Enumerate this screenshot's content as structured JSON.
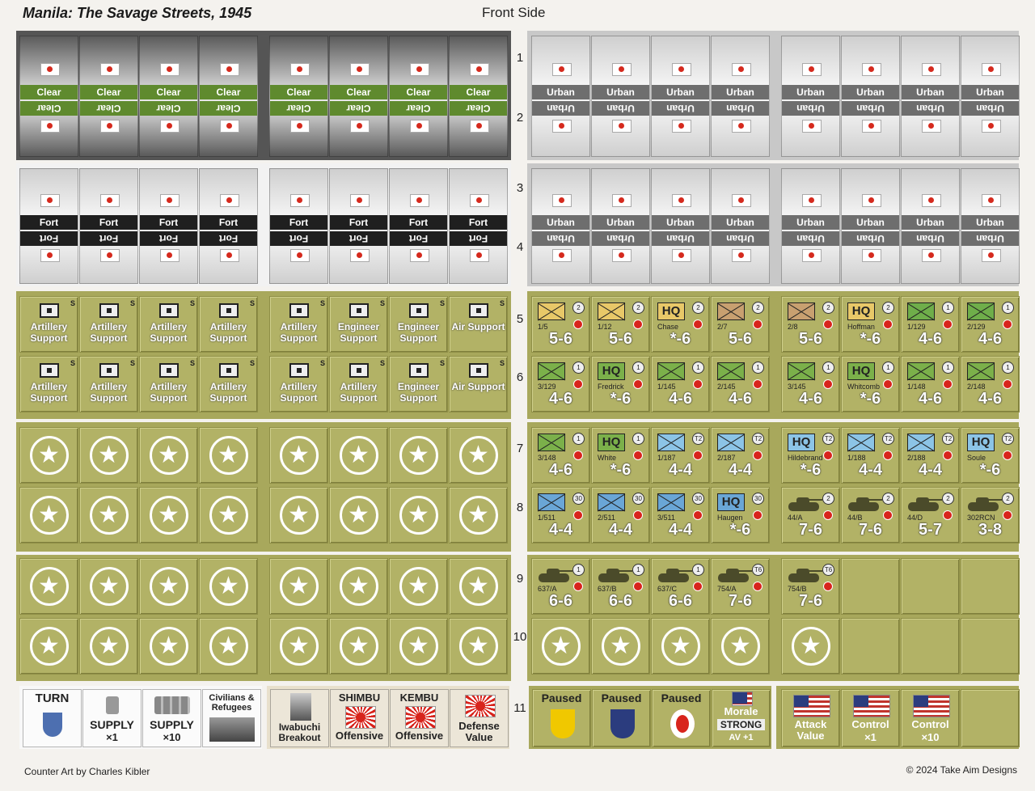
{
  "header": {
    "title": "Manila: The Savage Streets, 1945",
    "side": "Front Side"
  },
  "footer": {
    "credit": "Counter Art by Charles Kibler",
    "copyright": "© 2024 Take Aim Designs"
  },
  "row_numbers": [
    "1",
    "2",
    "3",
    "4",
    "5",
    "6",
    "7",
    "8",
    "9",
    "10",
    "11"
  ],
  "terrain": {
    "clear": "Clear",
    "urban": "Urban",
    "fort": "Fort"
  },
  "support": {
    "badge": "S",
    "row5": [
      "Artillery Support",
      "Artillery Support",
      "Artillery Support",
      "Artillery Support",
      "Artillery Support",
      "Engineer Support",
      "Engineer Support",
      "Air Support"
    ],
    "row6": [
      "Artillery Support",
      "Artillery Support",
      "Artillery Support",
      "Artillery Support",
      "Artillery Support",
      "Artillery Support",
      "Engineer Support",
      "Air Support"
    ]
  },
  "star_glyph": "★",
  "units": {
    "row5": [
      {
        "type": "inf",
        "id": "1/5",
        "str": "5-6",
        "size": "2"
      },
      {
        "type": "inf",
        "id": "1/12",
        "str": "5-6",
        "size": "2"
      },
      {
        "type": "hq",
        "hq": "HQ",
        "id": "Chase",
        "str": "*-6",
        "size": "2"
      },
      {
        "type": "inf",
        "id": "2/7",
        "str": "5-6",
        "size": "2"
      },
      {
        "type": "inf",
        "id": "2/8",
        "str": "5-6",
        "size": "2"
      },
      {
        "type": "hq",
        "hq": "HQ",
        "id": "Hoffman",
        "str": "*-6",
        "size": "2"
      },
      {
        "type": "inf",
        "id": "1/129",
        "str": "4-6",
        "size": "1"
      },
      {
        "type": "inf",
        "id": "2/129",
        "str": "4-6",
        "size": "1"
      }
    ],
    "row6": [
      {
        "type": "inf",
        "id": "3/129",
        "str": "4-6",
        "size": "1"
      },
      {
        "type": "hq",
        "hq": "HQ",
        "id": "Fredrick",
        "str": "*-6",
        "size": "1"
      },
      {
        "type": "inf",
        "id": "1/145",
        "str": "4-6",
        "size": "1"
      },
      {
        "type": "inf",
        "id": "2/145",
        "str": "4-6",
        "size": "1"
      },
      {
        "type": "inf",
        "id": "3/145",
        "str": "4-6",
        "size": "1"
      },
      {
        "type": "hq",
        "hq": "HQ",
        "id": "Whitcomb",
        "str": "*-6",
        "size": "1"
      },
      {
        "type": "inf",
        "id": "1/148",
        "str": "4-6",
        "size": "1"
      },
      {
        "type": "inf",
        "id": "2/148",
        "str": "4-6",
        "size": "1"
      }
    ],
    "row7": [
      {
        "type": "inf",
        "id": "3/148",
        "str": "4-6",
        "size": "1"
      },
      {
        "type": "hq",
        "hq": "HQ",
        "id": "White",
        "str": "*-6",
        "size": "1"
      },
      {
        "type": "inf",
        "id": "1/187",
        "str": "4-4",
        "size": "T2"
      },
      {
        "type": "inf",
        "id": "2/187",
        "str": "4-4",
        "size": "T2"
      },
      {
        "type": "hq",
        "hq": "HQ",
        "id": "Hildebrand",
        "str": "*-6",
        "size": "T2"
      },
      {
        "type": "inf",
        "id": "1/188",
        "str": "4-4",
        "size": "T2"
      },
      {
        "type": "inf",
        "id": "2/188",
        "str": "4-4",
        "size": "T2"
      },
      {
        "type": "hq",
        "hq": "HQ",
        "id": "Soule",
        "str": "*-6",
        "size": "T2"
      }
    ],
    "row8": [
      {
        "type": "inf",
        "id": "1/511",
        "str": "4-4",
        "size": "30"
      },
      {
        "type": "inf",
        "id": "2/511",
        "str": "4-4",
        "size": "30"
      },
      {
        "type": "inf",
        "id": "3/511",
        "str": "4-4",
        "size": "30"
      },
      {
        "type": "hq",
        "hq": "HQ",
        "id": "Haugen",
        "str": "*-6",
        "size": "30"
      },
      {
        "type": "tank",
        "id": "44/A",
        "str": "7-6",
        "size": "2"
      },
      {
        "type": "tank",
        "id": "44/B",
        "str": "7-6",
        "size": "2"
      },
      {
        "type": "tank",
        "id": "44/D",
        "str": "5-7",
        "size": "2"
      },
      {
        "type": "tank",
        "id": "302RCN",
        "str": "3-8",
        "size": "2"
      }
    ],
    "row9": [
      {
        "type": "tank",
        "id": "637/A",
        "str": "6-6",
        "size": "1"
      },
      {
        "type": "tank",
        "id": "637/B",
        "str": "6-6",
        "size": "1"
      },
      {
        "type": "tank",
        "id": "637/C",
        "str": "6-6",
        "size": "1"
      },
      {
        "type": "tank",
        "id": "754/A",
        "str": "7-6",
        "size": "T6"
      },
      {
        "type": "tank",
        "id": "754/B",
        "str": "7-6",
        "size": "T6"
      }
    ]
  },
  "markers": {
    "turn": "TURN",
    "supply1": "SUPPLY",
    "supply1_mult": "×1",
    "supply10": "SUPPLY",
    "supply10_mult": "×10",
    "civilians": "Civilians & Refugees",
    "iwabuchi": "Iwabuchi Breakout",
    "shimbu_top": "SHIMBU",
    "shimbu_bot": "Offensive",
    "kembu_top": "KEMBU",
    "kembu_bot": "Offensive",
    "defense": "Defense Value",
    "paused": "Paused",
    "morale": "Morale",
    "morale_state": "STRONG",
    "morale_av": "AV +1",
    "attack": "Attack Value",
    "control1": "Control",
    "control1_mult": "×1",
    "control10": "Control",
    "control10_mult": "×10"
  },
  "colors": {
    "olive": "#b2b266",
    "clear_band": "#5f8a2e",
    "fort_band": "#1f1f1f",
    "urban_band": "#6e6e6e",
    "red": "#d8241c"
  }
}
